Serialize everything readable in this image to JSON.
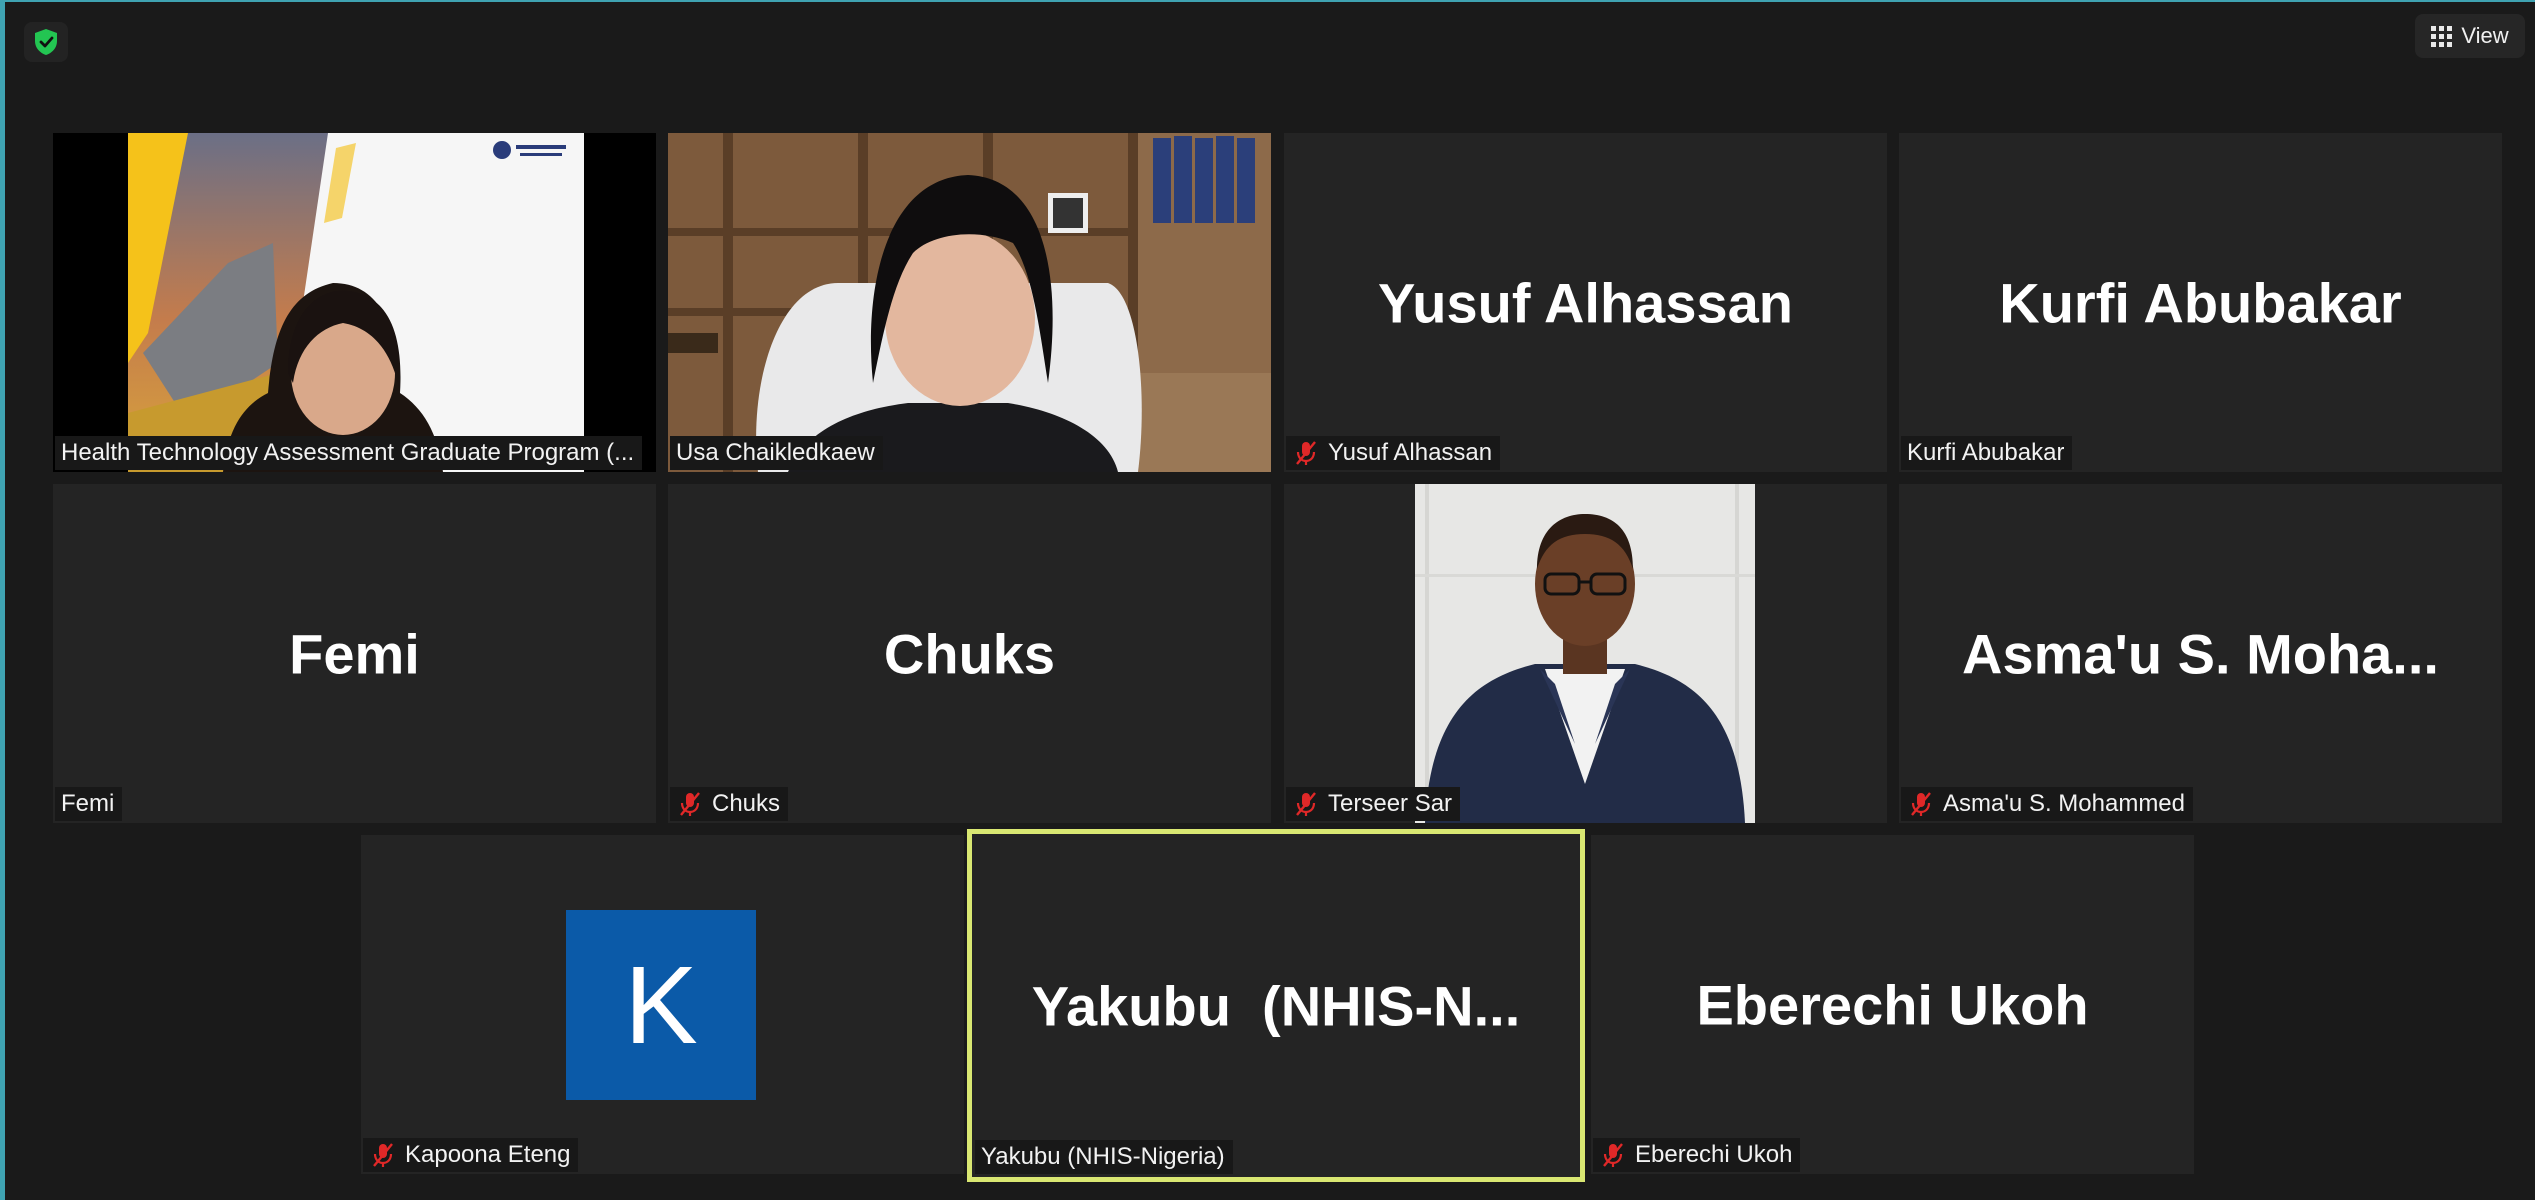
{
  "toolbar": {
    "view_label": "View",
    "security_icon": "shield-check-icon",
    "view_icon": "grid-icon"
  },
  "colors": {
    "background": "#1a1a1a",
    "tile": "#242424",
    "active_speaker_border": "#d9e772",
    "muted_icon": "#e02828",
    "shield": "#23c552",
    "avatar": "#0b5aa8"
  },
  "participants": [
    {
      "display_name": "Health Technology Assessment Graduate Program (...",
      "video": true,
      "muted": false
    },
    {
      "display_name": "Usa Chaikledkaew",
      "video": true,
      "muted": false
    },
    {
      "tile_name": "Yusuf Alhassan",
      "display_name": "Yusuf Alhassan",
      "video": false,
      "muted": true
    },
    {
      "tile_name": "Kurfi Abubakar",
      "display_name": "Kurfi Abubakar",
      "video": false,
      "muted": false
    },
    {
      "tile_name": "Femi",
      "display_name": "Femi",
      "video": false,
      "muted": false
    },
    {
      "tile_name": "Chuks",
      "display_name": "Chuks",
      "video": false,
      "muted": true
    },
    {
      "display_name": "Terseer Sar",
      "video": true,
      "muted": true
    },
    {
      "tile_name": "Asma'u S. Moha...",
      "display_name": "Asma'u S. Mohammed",
      "video": false,
      "muted": true
    },
    {
      "avatar_letter": "K",
      "display_name": "Kapoona Eteng",
      "video": false,
      "muted": true
    },
    {
      "tile_name": "Yakubu  (NHIS-N...",
      "display_name": "Yakubu (NHIS-Nigeria)",
      "video": false,
      "muted": false,
      "active_speaker": true
    },
    {
      "tile_name": "Eberechi Ukoh",
      "display_name": "Eberechi Ukoh",
      "video": false,
      "muted": true
    }
  ]
}
